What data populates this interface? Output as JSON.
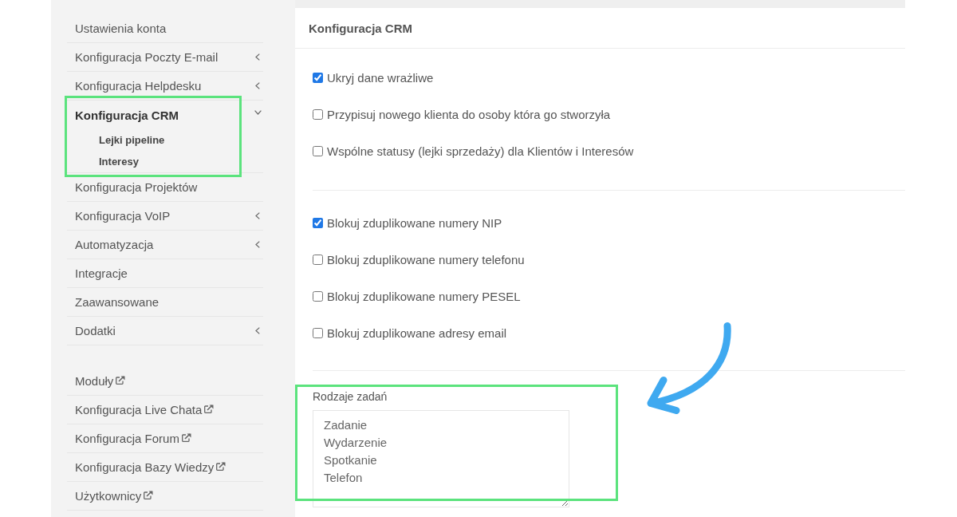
{
  "sidebar": {
    "groups": [
      {
        "items": [
          {
            "label": "Ustawienia konta",
            "kind": "plain",
            "selected": false,
            "highlighted": false
          },
          {
            "label": "Konfiguracja Poczty E-mail",
            "kind": "submenu",
            "expanded": false,
            "selected": false,
            "highlighted": false
          },
          {
            "label": "Konfiguracja Helpdesku",
            "kind": "submenu",
            "expanded": false,
            "selected": false,
            "highlighted": false
          },
          {
            "label": "Konfiguracja CRM",
            "kind": "submenu",
            "expanded": true,
            "selected": true,
            "highlighted": true,
            "children": [
              {
                "label": "Lejki pipeline"
              },
              {
                "label": "Interesy"
              }
            ]
          },
          {
            "label": "Konfiguracja Projektów",
            "kind": "plain",
            "selected": false,
            "highlighted": false
          },
          {
            "label": "Konfiguracja VoIP",
            "kind": "submenu",
            "expanded": false,
            "selected": false,
            "highlighted": false
          },
          {
            "label": "Automatyzacja",
            "kind": "submenu",
            "expanded": false,
            "selected": false,
            "highlighted": false
          },
          {
            "label": "Integracje",
            "kind": "plain",
            "selected": false,
            "highlighted": false
          },
          {
            "label": "Zaawansowane",
            "kind": "plain",
            "selected": false,
            "highlighted": false
          },
          {
            "label": "Dodatki",
            "kind": "submenu",
            "expanded": false,
            "selected": false,
            "highlighted": false
          }
        ]
      },
      {
        "items": [
          {
            "label": "Moduły",
            "kind": "external",
            "selected": false,
            "highlighted": false
          },
          {
            "label": "Konfiguracja Live Chata",
            "kind": "external",
            "selected": false,
            "highlighted": false
          },
          {
            "label": "Konfiguracja Forum",
            "kind": "external",
            "selected": false,
            "highlighted": false
          },
          {
            "label": "Konfiguracja Bazy Wiedzy",
            "kind": "external",
            "selected": false,
            "highlighted": false
          },
          {
            "label": "Użytkownicy",
            "kind": "external",
            "selected": false,
            "highlighted": false
          }
        ]
      }
    ]
  },
  "panel": {
    "title": "Konfiguracja CRM",
    "sections": [
      {
        "kind": "checkboxes",
        "items": [
          {
            "label": "Ukryj dane wrażliwe",
            "checked": true
          },
          {
            "label": "Przypisuj nowego klienta do osoby która go stworzyła",
            "checked": false
          },
          {
            "label": "Wspólne statusy (lejki sprzedaży) dla Klientów i Interesów",
            "checked": false
          }
        ]
      },
      {
        "kind": "checkboxes",
        "items": [
          {
            "label": "Blokuj zduplikowane numery NIP",
            "checked": true
          },
          {
            "label": "Blokuj zduplikowane numery telefonu",
            "checked": false
          },
          {
            "label": "Blokuj zduplikowane numery PESEL",
            "checked": false
          },
          {
            "label": "Blokuj zduplikowane adresy email",
            "checked": false
          }
        ]
      },
      {
        "kind": "textarea",
        "label": "Rodzaje zadań",
        "value": "Zadanie\nWydarzenie\nSpotkanie\nTelefon",
        "highlighted": true,
        "callout_arrow": true
      }
    ]
  }
}
